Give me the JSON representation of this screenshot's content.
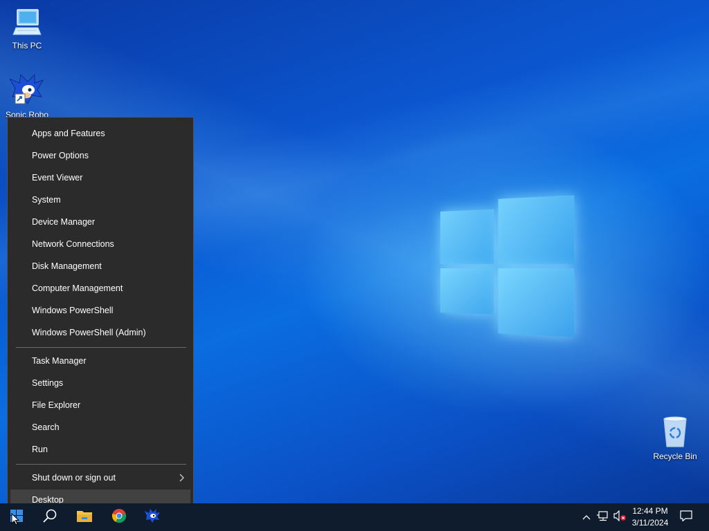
{
  "desktop": {
    "icons": [
      {
        "label": "This PC",
        "icon": "computer-icon"
      },
      {
        "label": "Sonic Robo",
        "icon": "sonic-shortcut-icon"
      },
      {
        "label": "Recycle Bin",
        "icon": "recycle-bin-icon"
      }
    ]
  },
  "menu": {
    "group1": [
      {
        "label": "Apps and Features"
      },
      {
        "label": "Power Options"
      },
      {
        "label": "Event Viewer"
      },
      {
        "label": "System"
      },
      {
        "label": "Device Manager"
      },
      {
        "label": "Network Connections"
      },
      {
        "label": "Disk Management"
      },
      {
        "label": "Computer Management"
      },
      {
        "label": "Windows PowerShell"
      },
      {
        "label": "Windows PowerShell (Admin)"
      }
    ],
    "group2": [
      {
        "label": "Task Manager"
      },
      {
        "label": "Settings"
      },
      {
        "label": "File Explorer"
      },
      {
        "label": "Search"
      },
      {
        "label": "Run"
      }
    ],
    "group3": [
      {
        "label": "Shut down or sign out",
        "has_submenu": true
      },
      {
        "label": "Desktop",
        "highlighted": true
      }
    ]
  },
  "taskbar": {
    "items": [
      "start-icon",
      "search-icon",
      "file-explorer-icon",
      "chrome-icon",
      "sonic-app-icon"
    ],
    "tray_icons": [
      "chevron-up-icon",
      "network-icon",
      "volume-muted-icon"
    ],
    "clock": {
      "time": "12:44 PM",
      "date": "3/11/2024"
    },
    "notification_icon": "action-center-icon"
  },
  "colors": {
    "menu_bg": "#2b2b2b",
    "menu_highlight": "#414141",
    "taskbar_bg": "#0f1c2e"
  }
}
